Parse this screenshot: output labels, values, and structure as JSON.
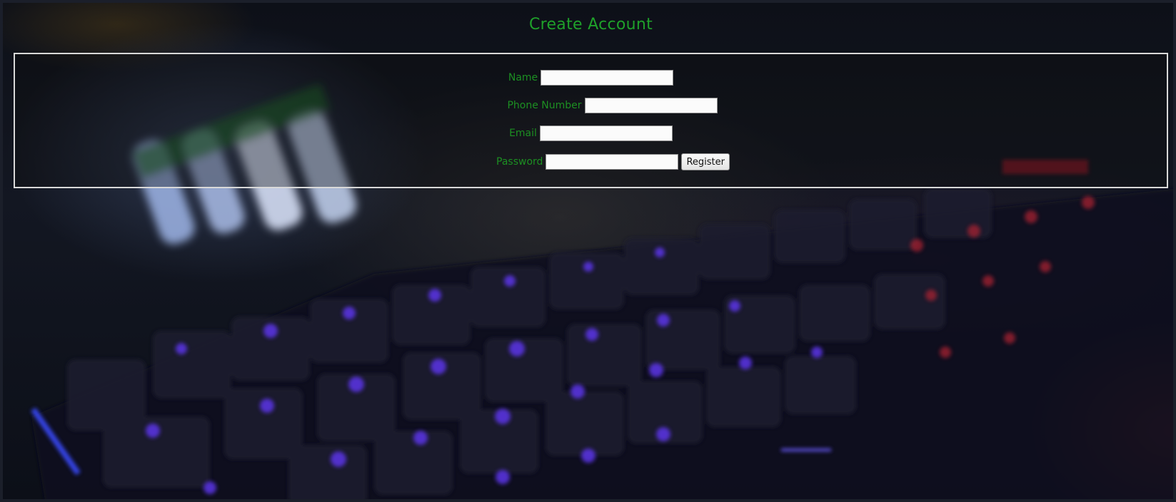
{
  "page": {
    "title": "Create Account"
  },
  "form": {
    "fields": [
      {
        "label": "Name",
        "value": "",
        "placeholder": ""
      },
      {
        "label": "Phone Number",
        "value": "",
        "placeholder": ""
      },
      {
        "label": "Email",
        "value": "",
        "placeholder": ""
      },
      {
        "label": "Password",
        "value": "",
        "placeholder": ""
      }
    ],
    "submit_label": "Register"
  },
  "colors": {
    "label_green": "#1c8f22",
    "title_green": "#1fa12a",
    "border": "#d9d9d9",
    "key_glow": "#6a3cff"
  }
}
